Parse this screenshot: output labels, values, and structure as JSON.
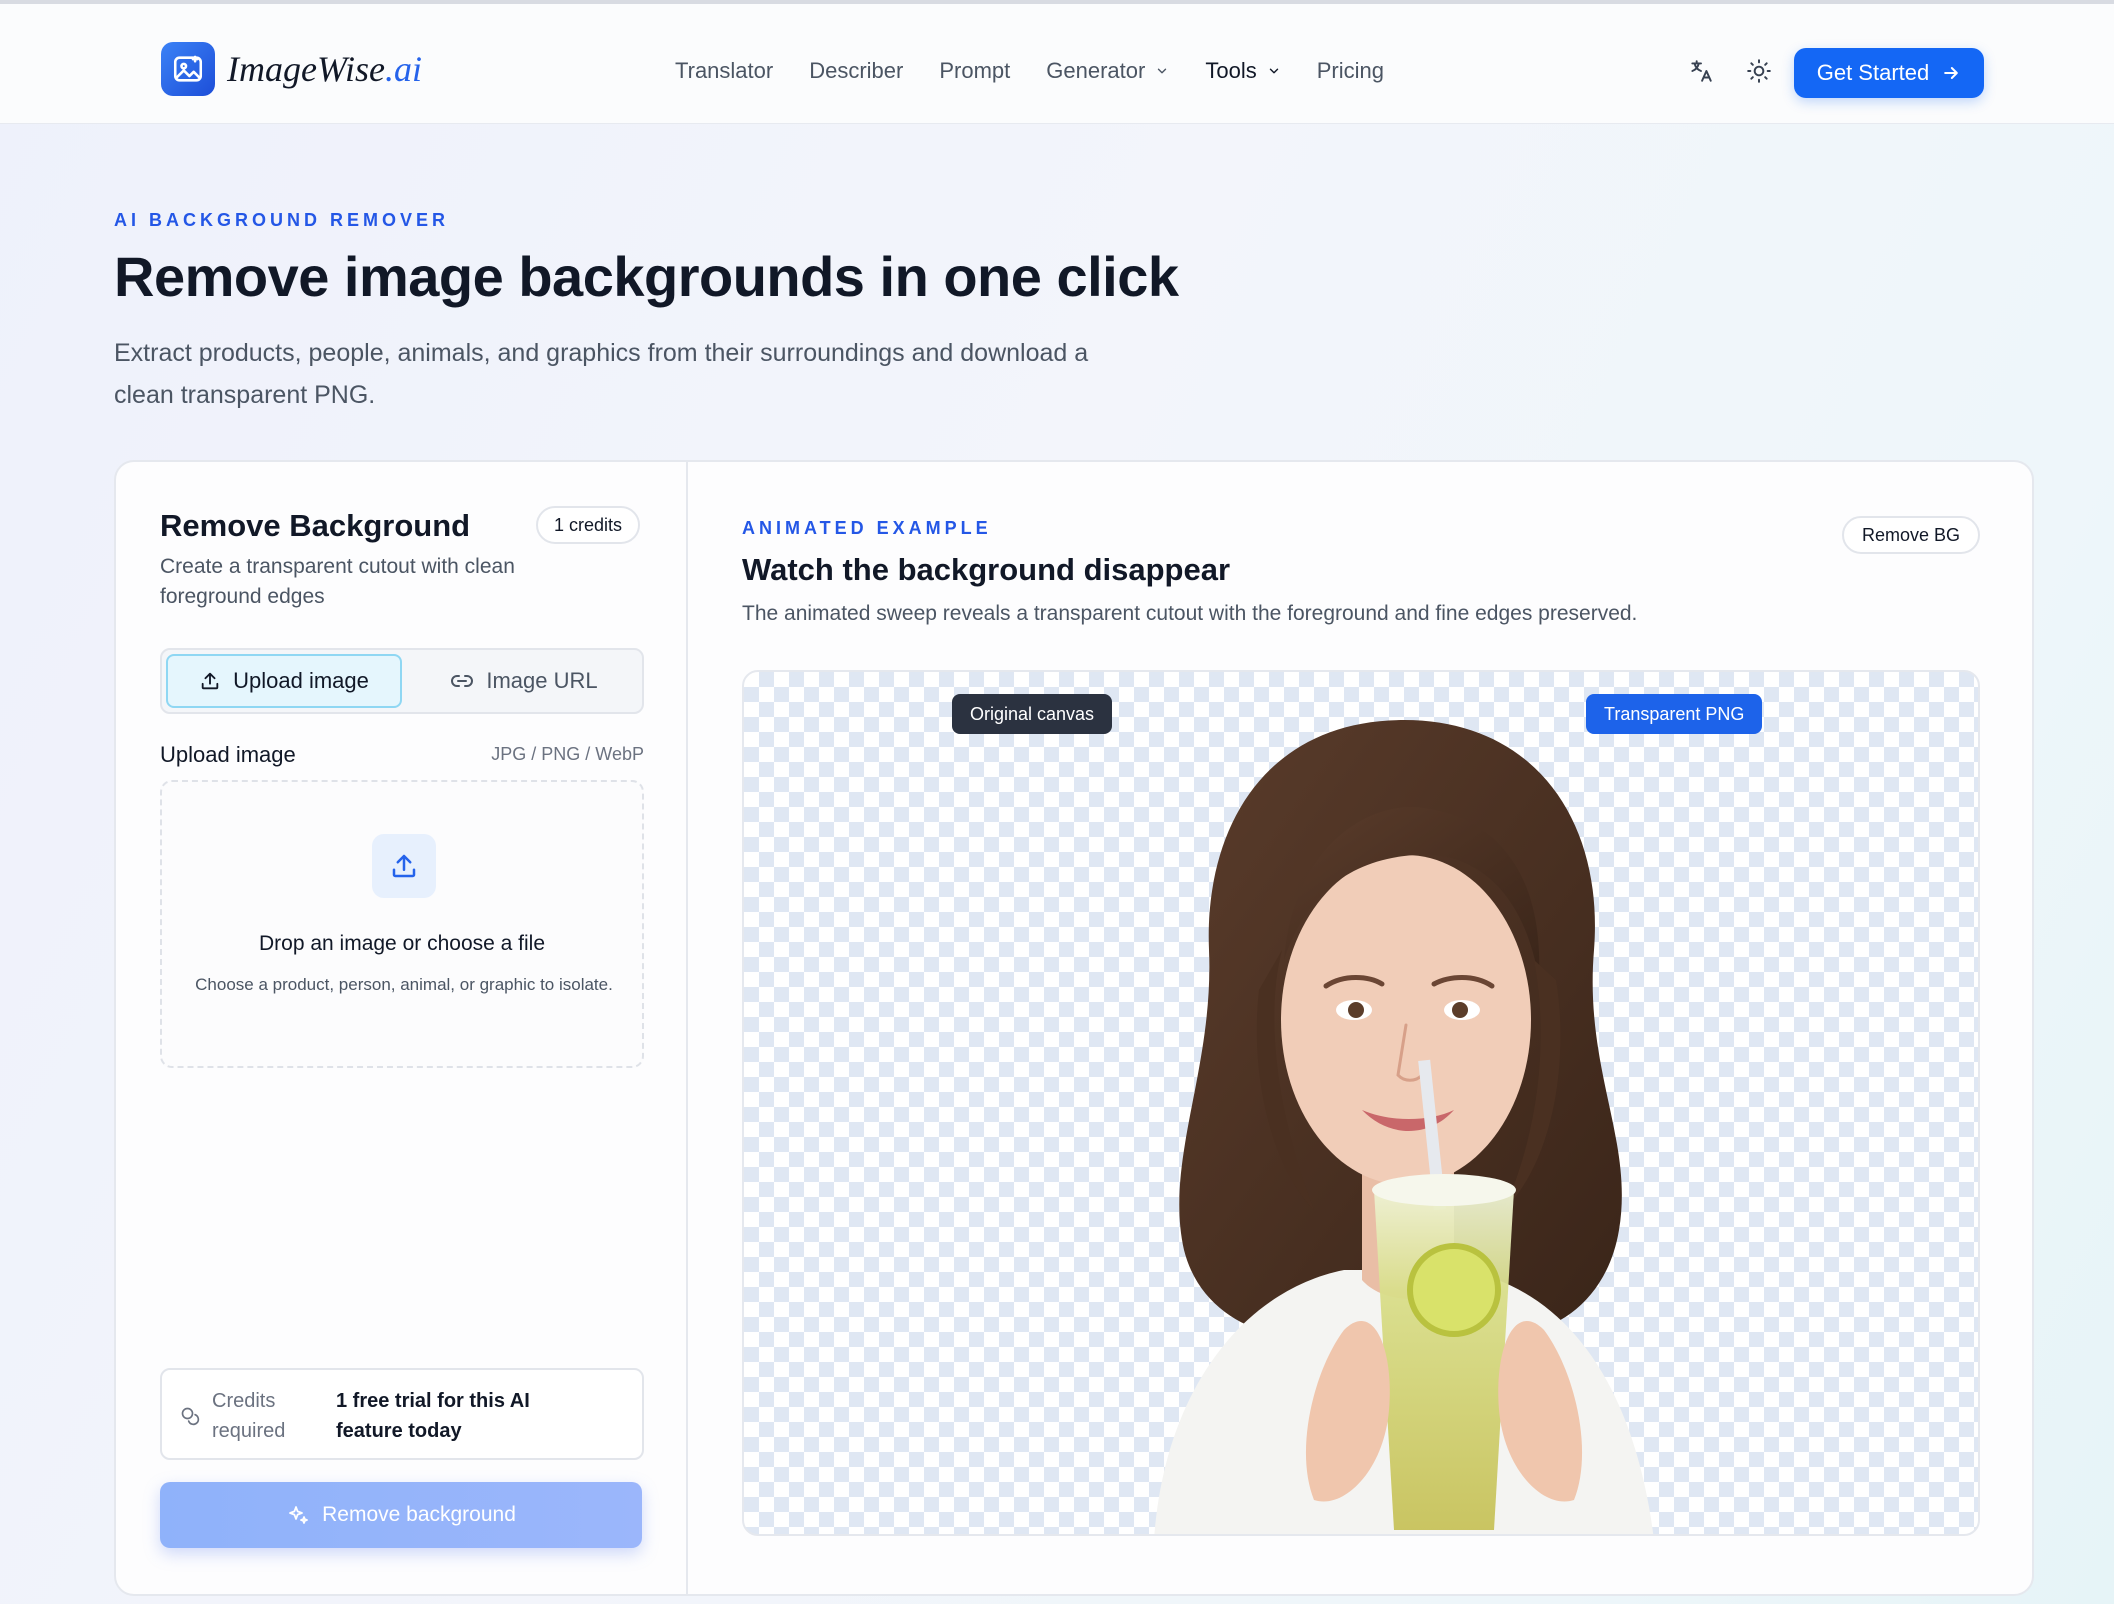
{
  "brand": {
    "name": "ImageWise",
    "suffix": ".ai"
  },
  "nav": {
    "items": [
      {
        "label": "Translator"
      },
      {
        "label": "Describer"
      },
      {
        "label": "Prompt"
      },
      {
        "label": "Generator",
        "dropdown": true
      },
      {
        "label": "Tools",
        "dropdown": true,
        "active": true
      },
      {
        "label": "Pricing"
      }
    ],
    "cta": "Get Started",
    "icons": [
      "translate-icon",
      "sun-icon",
      "arrow-right-icon"
    ]
  },
  "hero": {
    "eyebrow": "AI BACKGROUND REMOVER",
    "title": "Remove image backgrounds in one click",
    "subtitle": "Extract products, people, animals, and graphics from their surroundings and download a clean transparent PNG."
  },
  "panel": {
    "title": "Remove Background",
    "credits_badge": "1 credits",
    "subtitle": "Create a transparent cutout with clean foreground edges",
    "tabs": {
      "upload": "Upload image",
      "url": "Image URL"
    },
    "field_label": "Upload image",
    "formats": "JPG / PNG / WebP",
    "dropzone": {
      "title": "Drop an image or choose a file",
      "subtitle": "Choose a product, person, animal, or graphic to isolate."
    },
    "credits": {
      "label": "Credits required",
      "value": "1 free trial for this AI feature today"
    },
    "submit": "Remove background"
  },
  "example": {
    "eyebrow": "ANIMATED EXAMPLE",
    "title": "Watch the background disappear",
    "subtitle": "The animated sweep reveals a transparent cutout with the foreground and fine edges preserved.",
    "badge": "Remove BG",
    "tag_original": "Original canvas",
    "tag_transparent": "Transparent PNG"
  },
  "colors": {
    "accent": "#1467f5",
    "eyebrow": "#2457e6",
    "dark_tag": "#2b3240",
    "blue_tag": "#1d63ea"
  }
}
